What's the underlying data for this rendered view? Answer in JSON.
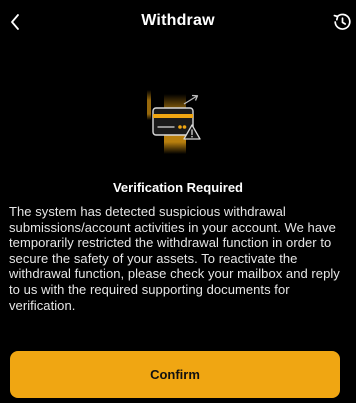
{
  "header": {
    "title": "Withdraw",
    "back_icon": "chevron-left-icon",
    "history_icon": "history-clock-icon"
  },
  "illustration": {
    "icon": "card-warning-icon"
  },
  "content": {
    "heading": "Verification Required",
    "message": "The system has detected suspicious withdrawal submissions/account activities in your account. We have temporarily restricted the withdrawal function in order to secure the safety of your assets. To reactivate the withdrawal function, please check your mailbox and reply to us with the required supporting documents for verification."
  },
  "actions": {
    "confirm_label": "Confirm"
  },
  "colors": {
    "background": "#000000",
    "accent": "#f0a612",
    "text": "#ffffff"
  }
}
